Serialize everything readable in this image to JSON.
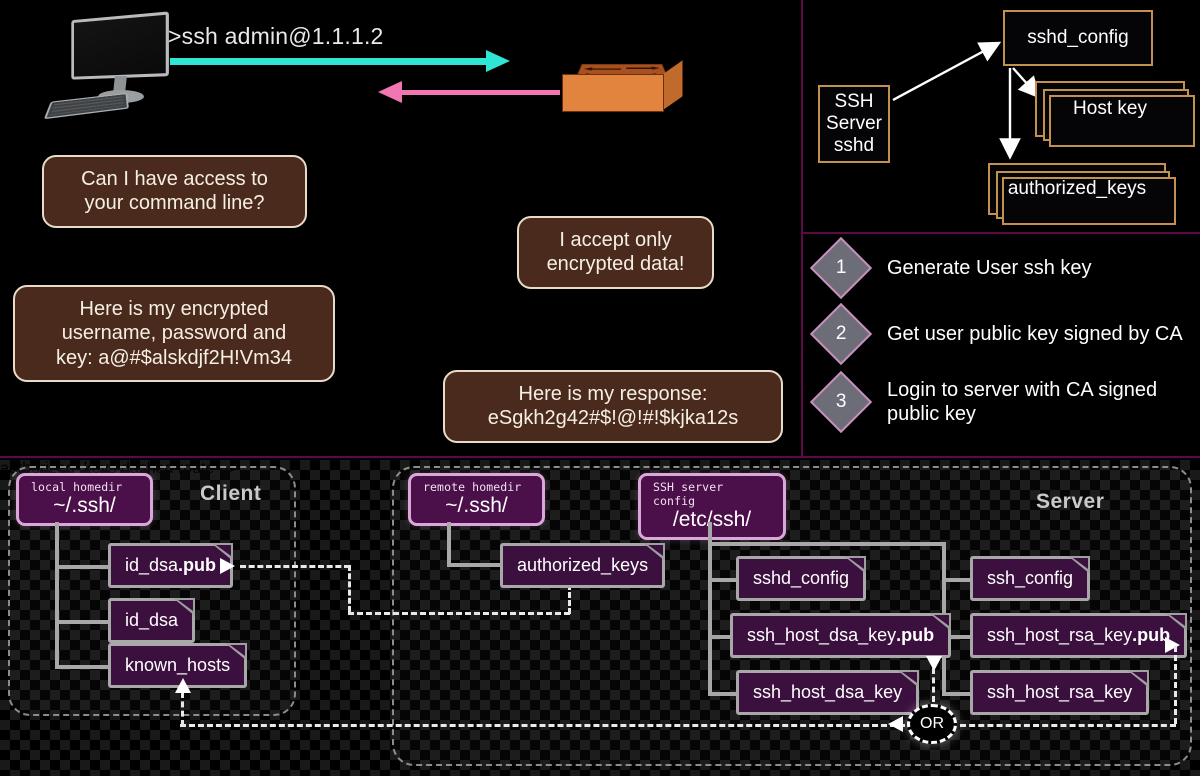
{
  "handshake": {
    "command": ">ssh admin@1.1.1.2",
    "client_icon": "desktop-computer-icon",
    "server_icon": "network-switch-icon",
    "arrow_out_color": "#2fe6d5",
    "arrow_in_color": "#f077b2",
    "bubbles": [
      {
        "id": "client-request",
        "text": "Can I have access to\nyour command line?"
      },
      {
        "id": "server-policy",
        "text": "I accept only\nencrypted data!"
      },
      {
        "id": "client-credentials",
        "text": "Here is my encrypted\nusername, password and\nkey: a@#$alskdjf2H!Vm34"
      },
      {
        "id": "server-response",
        "text": "Here is my response:\neSgkh2g42#$!@!#!$kjka12s"
      }
    ]
  },
  "sshd_structure": {
    "source": "SSH\nServer\nsshd",
    "nodes": [
      {
        "id": "sshd-config",
        "label": "sshd_config",
        "stacked": false
      },
      {
        "id": "host-key",
        "label": "Host key",
        "stacked": true
      },
      {
        "id": "authorized-keys",
        "label": "authorized_keys",
        "stacked": true
      }
    ]
  },
  "steps": [
    {
      "number": "1",
      "text": "Generate User ssh key"
    },
    {
      "number": "2",
      "text": "Get user public key signed by CA"
    },
    {
      "number": "3",
      "text": "Login to server with CA signed\npublic key"
    }
  ],
  "filetree": {
    "client": {
      "title": "Client",
      "folder": {
        "sub": "local homedir",
        "path": "~/.ssh/"
      },
      "files": [
        {
          "name": "id_dsa",
          "suffix": ".pub"
        },
        {
          "name": "id_dsa",
          "suffix": ""
        },
        {
          "name": "known_hosts",
          "suffix": ""
        }
      ]
    },
    "server": {
      "title": "Server",
      "home_folder": {
        "sub": "remote homedir",
        "path": "~/.ssh/"
      },
      "home_files": [
        {
          "name": "authorized_keys",
          "suffix": ""
        }
      ],
      "config_folder": {
        "sub": "SSH server config",
        "path": "/etc/ssh/"
      },
      "config_files_left": [
        {
          "name": "sshd_config",
          "suffix": ""
        },
        {
          "name": "ssh_host_dsa_key",
          "suffix": ".pub"
        },
        {
          "name": "ssh_host_dsa_key",
          "suffix": ""
        }
      ],
      "config_files_right": [
        {
          "name": "ssh_config",
          "suffix": ""
        },
        {
          "name": "ssh_host_rsa_key",
          "suffix": ".pub"
        },
        {
          "name": "ssh_host_rsa_key",
          "suffix": ""
        }
      ],
      "or_node": "OR"
    }
  },
  "colors": {
    "divider": "#5c0c42",
    "bubble_fill": "#4a2a1c",
    "bubble_border": "#e8dcc8",
    "gold_border": "#c2914e",
    "folder_fill": "#4b0f49",
    "folder_border": "#d9a8d8",
    "file_fill": "#3b0f3e",
    "file_border": "#a8a8a8"
  }
}
